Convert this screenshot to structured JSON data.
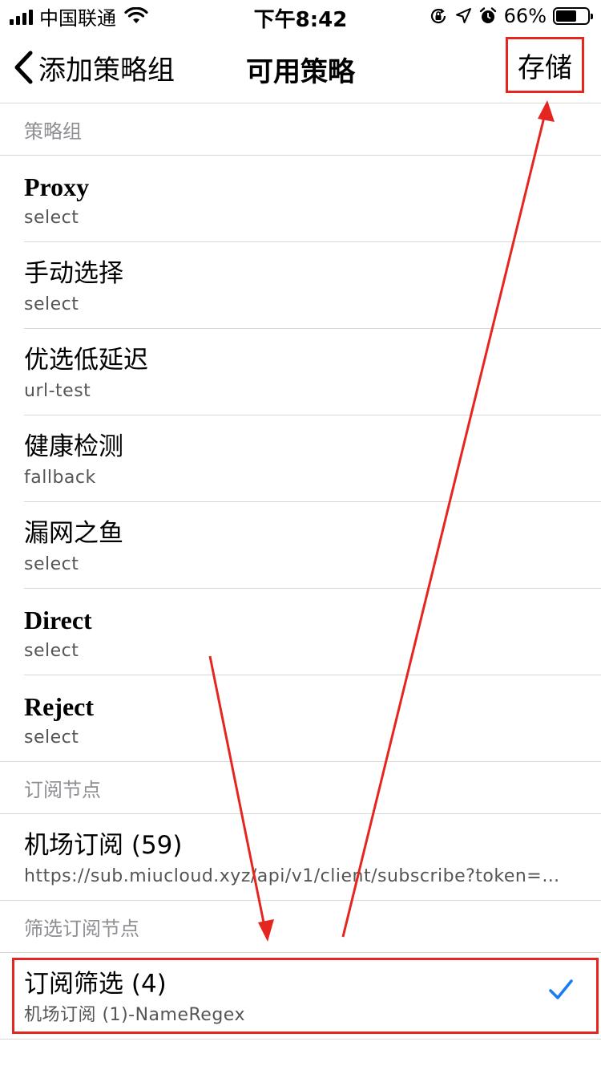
{
  "status_bar": {
    "carrier": "中国联通",
    "time": "下午8:42",
    "battery_percent": "66%",
    "battery_level": 0.66
  },
  "nav": {
    "back_label": "添加策略组",
    "title": "可用策略",
    "save_label": "存储"
  },
  "sections": {
    "policy_groups": "策略组",
    "subscription_nodes": "订阅节点",
    "filtered_nodes": "筛选订阅节点"
  },
  "policy_groups": [
    {
      "name": "Proxy",
      "type": "select"
    },
    {
      "name": "手动选择",
      "type": "select"
    },
    {
      "name": "优选低延迟",
      "type": "url-test"
    },
    {
      "name": "健康检测",
      "type": "fallback"
    },
    {
      "name": "漏网之鱼",
      "type": "select"
    },
    {
      "name": "Direct",
      "type": "select"
    },
    {
      "name": "Reject",
      "type": "select"
    }
  ],
  "subscription": {
    "name": "机场订阅 (59)",
    "url": "https://sub.miucloud.xyz/api/v1/client/subscribe?token=3f..."
  },
  "filtered": {
    "name": "订阅筛选 (4)",
    "detail": "机场订阅 (1)-NameRegex",
    "checked": true
  },
  "colors": {
    "accent": "#1a7cf5",
    "annotation_red": "#e5251f",
    "separator": "#d8d8d8",
    "secondary_text": "#8e8e93"
  }
}
